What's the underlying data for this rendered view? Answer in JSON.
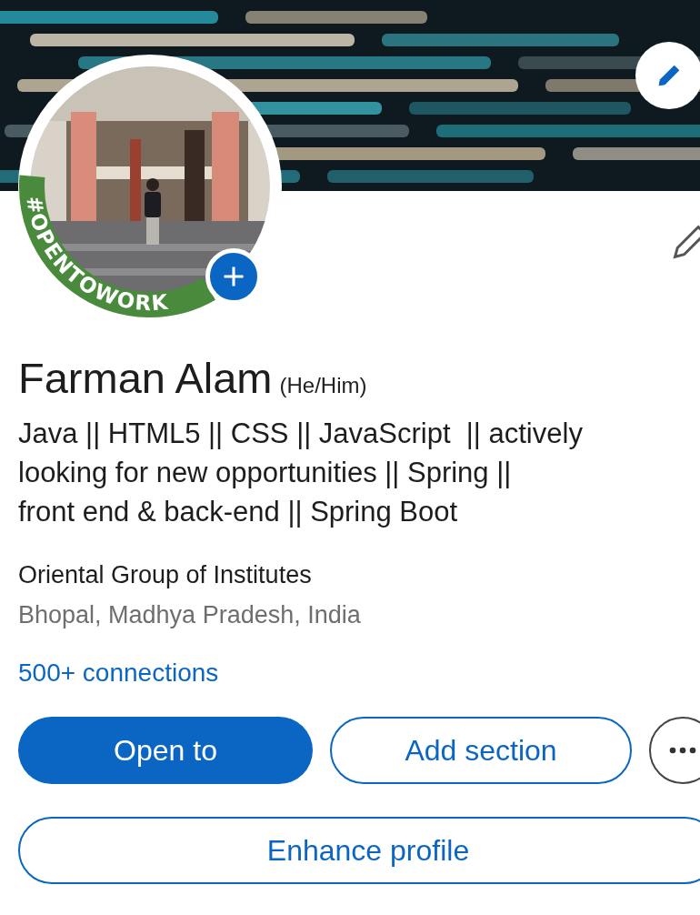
{
  "avatar": {
    "kind": "picture",
    "frame_label": "#OPENTOWORK"
  },
  "profile": {
    "name": "Farman Alam",
    "pronouns": "(He/Him)",
    "headline_lines": [
      "Java || HTML5 || CSS || JavaScript  || actively",
      "looking for new opportunities || Spring ||",
      "front end & back-end || Spring Boot"
    ],
    "organization": "Oriental Group of Institutes",
    "location": "Bhopal, Madhya Pradesh, India",
    "connections": "500+ connections"
  },
  "actions": [
    {
      "kind": "primary",
      "label": "Open to"
    },
    {
      "kind": "secondary",
      "label": "Add section"
    },
    {
      "kind": "more"
    }
  ],
  "wide_actions": [
    {
      "label": "Enhance profile"
    }
  ]
}
